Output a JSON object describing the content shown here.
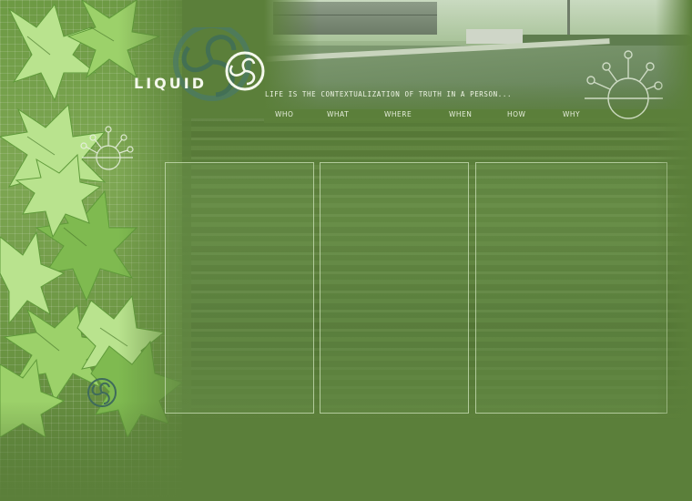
{
  "brand": {
    "logo_text": "LIQUID",
    "tagline": "LIFE IS THE CONTEXTUALIZATION OF TRUTH IN A PERSON..."
  },
  "nav": {
    "items": [
      {
        "label": "WHO"
      },
      {
        "label": "WHAT"
      },
      {
        "label": "WHERE"
      },
      {
        "label": "WHEN"
      },
      {
        "label": "HOW"
      },
      {
        "label": "WHY"
      }
    ]
  },
  "colors": {
    "background": "#5b7f3a",
    "leaf": "#9cd16a",
    "text": "#eef4e4"
  },
  "icons": [
    "triskelion-logo-icon",
    "sun-ornament-icon",
    "triskelion-watermark-icon"
  ]
}
